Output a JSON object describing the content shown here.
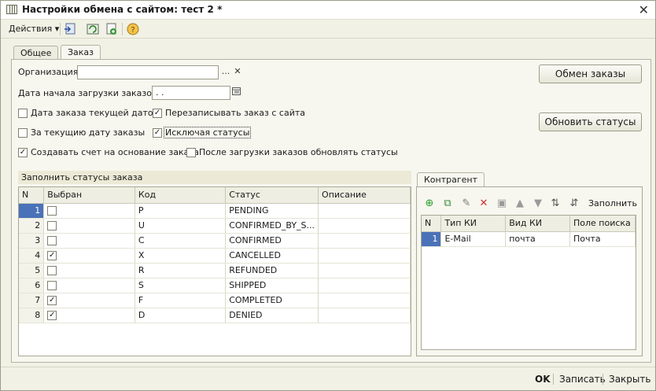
{
  "window": {
    "title": "Настройки обмена с сайтом: тест 2 *",
    "close_glyph": "✕"
  },
  "toolbar": {
    "actions_label": "Действия",
    "actions_arrow": "▾"
  },
  "tabs": [
    {
      "label": "Общее"
    },
    {
      "label": "Заказ"
    }
  ],
  "form": {
    "org_label": "Организация:",
    "org_value": "",
    "org_select_glyph": "...",
    "org_clear_glyph": "✕",
    "date_label": "Дата начала загрузки заказов:",
    "date_value": " .  .",
    "cb_date_current": {
      "label": "Дата заказа текущей датой",
      "checked": false
    },
    "cb_overwrite": {
      "label": "Перезаписывать заказ с сайта",
      "checked": true
    },
    "cb_today_orders": {
      "label": "За текущию дату заказы",
      "checked": false
    },
    "cb_exclude_statuses": {
      "label": "Исключая статусы",
      "checked": true
    },
    "cb_create_invoice": {
      "label": "Создавать счет на основание заказа",
      "checked": true
    },
    "cb_update_after_load": {
      "label": "После загрузки заказов обновлять статусы",
      "checked": false
    },
    "btn_exchange": "Обмен заказы",
    "btn_update_statuses": "Обновить статусы"
  },
  "statuses": {
    "group_title": "Заполнить статусы заказа",
    "columns": [
      "N",
      "Выбран",
      "Код",
      "Статус",
      "Описание"
    ],
    "rows": [
      {
        "n": "1",
        "checked": false,
        "code": "P",
        "status": "PENDING",
        "desc": ""
      },
      {
        "n": "2",
        "checked": false,
        "code": "U",
        "status": "CONFIRMED_BY_S...",
        "desc": ""
      },
      {
        "n": "3",
        "checked": false,
        "code": "C",
        "status": "CONFIRMED",
        "desc": ""
      },
      {
        "n": "4",
        "checked": true,
        "code": "X",
        "status": "CANCELLED",
        "desc": ""
      },
      {
        "n": "5",
        "checked": false,
        "code": "R",
        "status": "REFUNDED",
        "desc": ""
      },
      {
        "n": "6",
        "checked": false,
        "code": "S",
        "status": "SHIPPED",
        "desc": ""
      },
      {
        "n": "7",
        "checked": true,
        "code": "F",
        "status": "COMPLETED",
        "desc": ""
      },
      {
        "n": "8",
        "checked": true,
        "code": "D",
        "status": "DENIED",
        "desc": ""
      }
    ]
  },
  "counterparty": {
    "tab_label": "Контрагент",
    "fill_label": "Заполнить",
    "columns": [
      "N",
      "Тип КИ",
      "Вид КИ",
      "Поле поиска"
    ],
    "rows": [
      {
        "n": "1",
        "type": "E-Mail",
        "kind": "почта",
        "field": "Почта"
      }
    ]
  },
  "bottom": {
    "ok": "OK",
    "save": "Записать",
    "close": "Закрыть"
  },
  "colors": {
    "window_bg": "#f1f1e5",
    "selection": "#4a72b8",
    "panel": "#f7f7ef"
  }
}
